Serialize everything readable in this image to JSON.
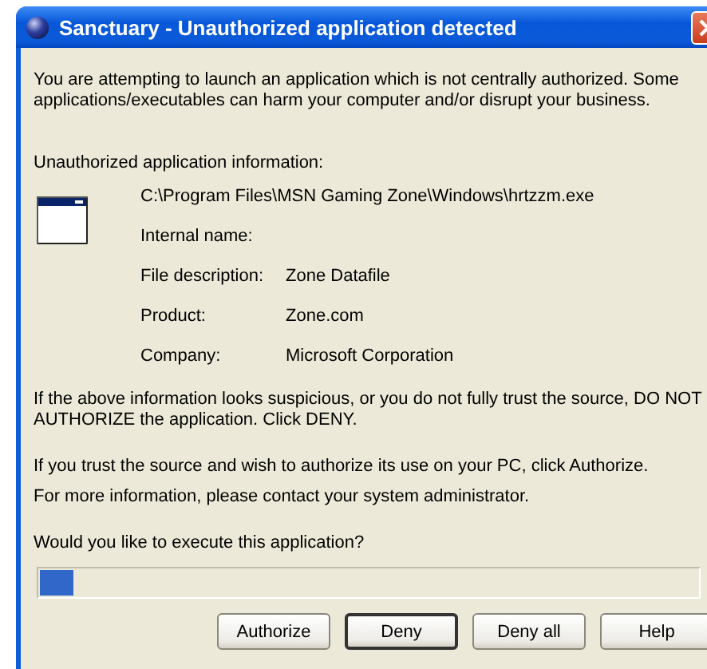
{
  "window": {
    "title": "Sanctuary - Unauthorized application detected"
  },
  "intro": "You are attempting to launch an application which is not centrally authorized. Some applications/executables can harm your computer and/or disrupt your business.",
  "info_heading": "Unauthorized application information:",
  "path": "C:\\Program Files\\MSN Gaming Zone\\Windows\\hrtzzm.exe",
  "details": [
    {
      "label": "Internal name:"
    },
    {
      "label": "File description:",
      "value": "Zone Datafile"
    },
    {
      "label": "Product:",
      "value": "Zone.com"
    },
    {
      "label": "Company:",
      "value": "Microsoft Corporation"
    }
  ],
  "warning": "If the above information looks suspicious, or you do not fully trust the source, DO NOT AUTHORIZE the application. Click DENY.",
  "trust_note": "If you trust the source and wish to authorize its use on your PC, click Authorize.",
  "contact_note": "For more information, please contact your system administrator.",
  "question": "Would you like to execute this application?",
  "progress": {
    "level": 0.05
  },
  "buttons": [
    {
      "label": "Authorize",
      "default": false
    },
    {
      "label": "Deny",
      "default": true
    },
    {
      "label": "Deny all",
      "default": false
    },
    {
      "label": "Help",
      "default": false
    }
  ]
}
